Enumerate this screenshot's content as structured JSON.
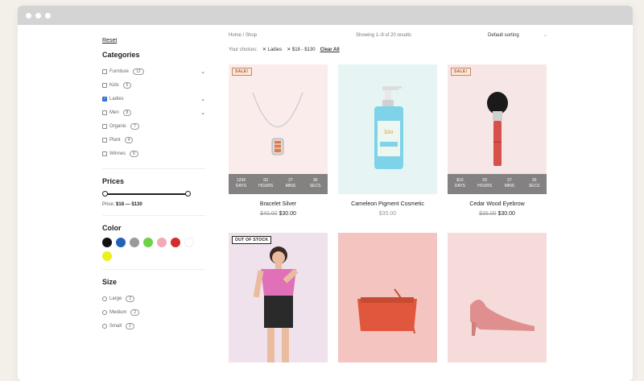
{
  "sidebar": {
    "reset_label": "Reset",
    "categories_title": "Categories",
    "categories": [
      {
        "label": "Furniture",
        "count": "13",
        "checked": false,
        "expandable": true
      },
      {
        "label": "Kids",
        "count": "6",
        "checked": false,
        "expandable": false
      },
      {
        "label": "Ladies",
        "count": "",
        "checked": true,
        "expandable": true
      },
      {
        "label": "Men",
        "count": "8",
        "checked": false,
        "expandable": true
      },
      {
        "label": "Organic",
        "count": "7",
        "checked": false,
        "expandable": false
      },
      {
        "label": "Plant",
        "count": "4",
        "checked": false,
        "expandable": false
      },
      {
        "label": "Winnes",
        "count": "8",
        "checked": false,
        "expandable": false
      }
    ],
    "prices_title": "Prices",
    "price_label": "Price:",
    "price_range": "$18 — $130",
    "color_title": "Color",
    "colors": [
      "#111111",
      "#2462b8",
      "#9a9a9a",
      "#6fd04a",
      "#f2aab8",
      "#d42c2c",
      "#ffffff",
      "#eef019"
    ],
    "size_title": "Size",
    "sizes": [
      {
        "label": "Large",
        "count": "2"
      },
      {
        "label": "Medium",
        "count": "2"
      },
      {
        "label": "Small",
        "count": "2"
      }
    ]
  },
  "main": {
    "breadcrumb": "Home / Shop",
    "showing": "Showing 1–9 of 20 results",
    "sorting": "Default sorting",
    "choices_label": "Your choices:",
    "choices": [
      "✕ Ladies",
      "✕ $18 - $130"
    ],
    "clear_all": "Clear All"
  },
  "products": [
    {
      "name": "Bracelet Silver",
      "old_price": "$40.00",
      "price": "$30.00",
      "badge": "SALE!",
      "countdown": [
        {
          "v": "1234",
          "l": "DAYS"
        },
        {
          "v": "03",
          "l": "HOURS"
        },
        {
          "v": "27",
          "l": "MINS"
        },
        {
          "v": "30",
          "l": "SECS"
        }
      ],
      "bg": "#fbecec"
    },
    {
      "name": "Cameleon Pigment Cosmetic",
      "old_price": "",
      "price": "$35.00",
      "badge": "",
      "countdown": [],
      "bg": "#e6f5f4"
    },
    {
      "name": "Cedar Wood Eyebrow",
      "old_price": "$35.00",
      "price": "$30.00",
      "badge": "SALE!",
      "countdown": [
        {
          "v": "$10",
          "l": "DAYS"
        },
        {
          "v": "03",
          "l": "HOURS"
        },
        {
          "v": "27",
          "l": "MINS"
        },
        {
          "v": "30",
          "l": "SECS"
        }
      ],
      "bg": "#f6e6e6"
    },
    {
      "name": "",
      "old_price": "",
      "price": "",
      "badge": "OUT OF STOCK",
      "countdown": [],
      "bg": "#f0e2ec"
    },
    {
      "name": "",
      "old_price": "",
      "price": "",
      "badge": "",
      "countdown": [],
      "bg": "#f3c4c0"
    },
    {
      "name": "",
      "old_price": "",
      "price": "",
      "badge": "",
      "countdown": [],
      "bg": "#f5dcdb"
    }
  ]
}
